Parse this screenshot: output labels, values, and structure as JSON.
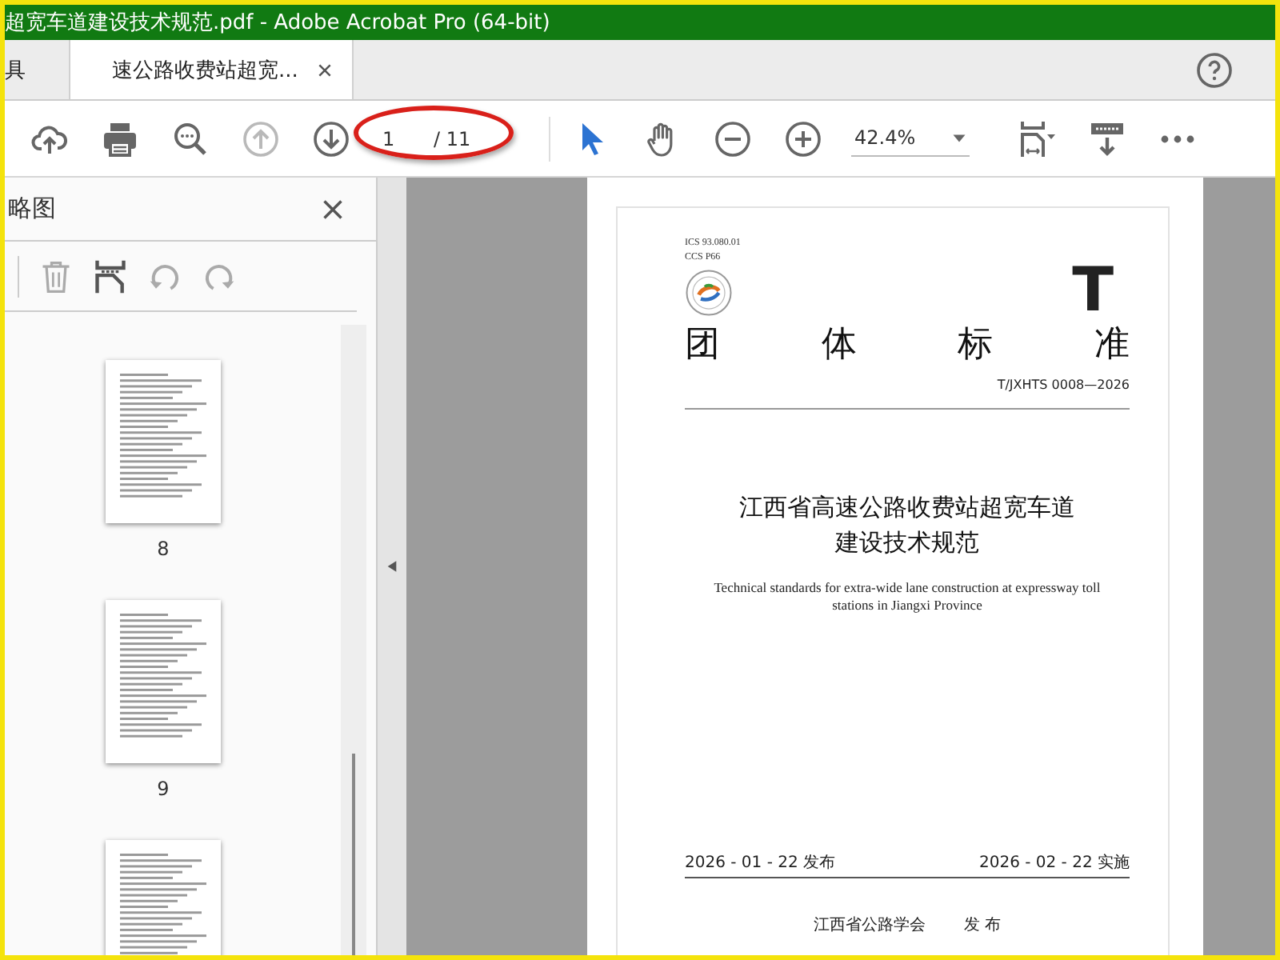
{
  "window": {
    "title": "超宽车道建设技术规范.pdf - Adobe Acrobat Pro (64-bit)"
  },
  "tabs": [
    {
      "label": "具",
      "kind": "home",
      "selected": false
    },
    {
      "label": "速公路收费站超宽...",
      "kind": "document",
      "selected": true
    }
  ],
  "toolbar": {
    "page_field": {
      "value": "1",
      "total": "/ 11"
    },
    "zoom_field": {
      "value": "42.4%"
    },
    "tools": [
      {
        "kind": "upload",
        "disabled": false,
        "selected": false
      },
      {
        "kind": "print",
        "disabled": false,
        "selected": false
      },
      {
        "kind": "find",
        "disabled": false,
        "selected": false
      },
      {
        "kind": "prev",
        "disabled": true,
        "selected": false
      },
      {
        "kind": "next",
        "disabled": false,
        "selected": false
      },
      {
        "kind": "pagefield"
      },
      {
        "kind": "select",
        "disabled": false,
        "selected": true
      },
      {
        "kind": "hand",
        "disabled": false,
        "selected": false
      },
      {
        "kind": "zoomout",
        "disabled": false,
        "selected": false
      },
      {
        "kind": "zoomin",
        "disabled": false,
        "selected": false
      },
      {
        "kind": "zoomfield"
      },
      {
        "kind": "fit",
        "disabled": false,
        "selected": false
      },
      {
        "kind": "scroll",
        "disabled": false,
        "selected": false
      },
      {
        "kind": "more",
        "disabled": false,
        "selected": false
      }
    ]
  },
  "annotation": {
    "kind": "ellipse"
  },
  "sidebar": {
    "title": "略图",
    "tools": [
      {
        "kind": "delete",
        "disabled": true
      },
      {
        "kind": "insert",
        "disabled": false
      },
      {
        "kind": "rotleft",
        "disabled": true
      },
      {
        "kind": "rotright",
        "disabled": true
      }
    ],
    "thumbnails": [
      {
        "kind": "page",
        "label": "8"
      },
      {
        "kind": "page",
        "label": "9"
      },
      {
        "kind": "page"
      }
    ]
  },
  "document": {
    "ics": "ICS  93.080.01",
    "ccs": "CCS  P66",
    "letter": "T",
    "heading": [
      "团",
      "体",
      "标",
      "准"
    ],
    "code": "T/JXHTS 0008—2026",
    "title_lines": [
      "江西省高速公路收费站超宽车道",
      "建设技术规范"
    ],
    "english_title": "Technical standards for extra-wide lane construction at expressway toll stations in Jiangxi Province",
    "issue_date": "2026 - 01 - 22 发布",
    "effective_date": "2026 - 02 - 22 实施",
    "publisher": "江西省公路学会",
    "publish_word": "发 布"
  }
}
